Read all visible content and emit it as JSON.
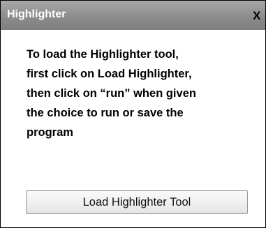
{
  "window": {
    "title": "Highlighter",
    "close_label": "X"
  },
  "message": {
    "lines": [
      "To load the Highlighter tool,",
      "first click on Load Highlighter,",
      "then click on “run” when given",
      "the choice to run or save the",
      "program"
    ]
  },
  "actions": {
    "load_label": "Load Highlighter Tool"
  },
  "colors": {
    "title_bar": "#8c8c8c",
    "title_text": "#ffffff",
    "border": "#000000",
    "button_border": "#9a9a9a"
  }
}
